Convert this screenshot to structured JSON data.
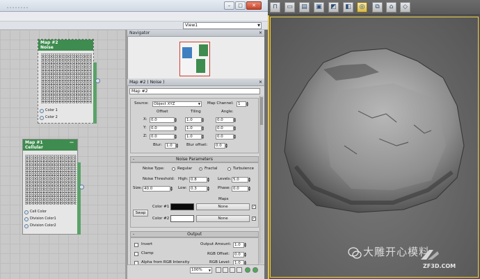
{
  "editor": {
    "view_selector": "View1"
  },
  "nodes": [
    {
      "title": "Map #2",
      "subtitle": "Noise",
      "inputs": [
        "Color 1",
        "Color 2"
      ]
    },
    {
      "title": "Map #1",
      "subtitle": "Cellular",
      "inputs": [
        "Cell Color",
        "Division Color1",
        "Division Color2"
      ]
    }
  ],
  "navigator": {
    "title": "Navigator"
  },
  "params": {
    "title": "Map #2 ( Noise )",
    "name_field": "Map #2",
    "coordinates": {
      "source_label": "Source:",
      "source_value": "Object XYZ",
      "map_channel_label": "Map Channel:",
      "map_channel_value": "1",
      "col_offset": "Offset",
      "col_tiling": "Tiling",
      "col_angle": "Angle:",
      "rows": [
        {
          "axis": "X:",
          "offset": "0.0",
          "tiling": "1.0",
          "angle": "0.0"
        },
        {
          "axis": "Y:",
          "offset": "0.0",
          "tiling": "1.0",
          "angle": "0.0"
        },
        {
          "axis": "Z:",
          "offset": "0.0",
          "tiling": "1.0",
          "angle": "0.0"
        }
      ],
      "blur_label": "Blur:",
      "blur_value": "1.0",
      "blur_offset_label": "Blur offset:",
      "blur_offset_value": "0.0"
    },
    "noise": {
      "header": "Noise Parameters",
      "type_label": "Noise Type:",
      "type_regular": "Regular",
      "type_fractal": "Fractal",
      "type_turbulence": "Turbulence",
      "selected_type": "Fractal",
      "threshold_label": "Noise Threshold:",
      "high_label": "High:",
      "high_value": "0.8",
      "levels_label": "Levels:",
      "levels_value": "5.0",
      "size_label": "Size:",
      "size_value": "40.0",
      "low_label": "Low:",
      "low_value": "0.3",
      "phase_label": "Phase:",
      "phase_value": "0.0",
      "maps_label": "Maps",
      "swap_label": "Swap",
      "color1_label": "Color #1",
      "color1_hex": "#0a0a0a",
      "color1_map": "None",
      "color2_label": "Color #2",
      "color2_hex": "#ffffff",
      "color2_map": "None"
    },
    "output": {
      "header": "Output",
      "invert_label": "Invert",
      "clamp_label": "Clamp",
      "alpha_label": "Alpha from RGB Intensity",
      "amount_label": "Output Amount:",
      "amount_value": "1.0",
      "rgb_offset_label": "RGB Offset:",
      "rgb_offset_value": "0.0",
      "rgb_level_label": "RGB Level:",
      "rgb_level_value": "1.0"
    }
  },
  "status": {
    "zoom": "100%"
  },
  "watermark": {
    "text": "大雕开心模料",
    "site": "ZF3D.COM"
  }
}
